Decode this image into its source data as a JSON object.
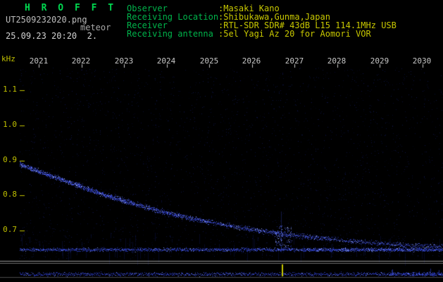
{
  "app": {
    "title": "H R O F F T",
    "filename": "UT2509232020.png",
    "mode_label": "meteor",
    "datetime": "25.09.23 20:20  2."
  },
  "header": {
    "observer_label": "Observer",
    "observer_value": ":Masaki Kano",
    "location_label": "Receiving Location",
    "location_value": ":Shibukawa,Gunma,Japan",
    "receiver_label": "Receiver",
    "receiver_value": ":RTL-SDR SDR# 43dB L15 114.1MHz USB",
    "antenna_label": "Receiving antenna",
    "antenna_value": ":5el Yagi Az 20 for Aomori VOR"
  },
  "chart_data": {
    "type": "heatmap",
    "subtype": "radio-meteor-spectrogram",
    "title": "",
    "xlabel": "",
    "ylabel": "kHz",
    "x_tick_labels": [
      "2021",
      "2022",
      "2023",
      "2024",
      "2025",
      "2026",
      "2027",
      "2028",
      "2029",
      "2030"
    ],
    "y_tick_labels": [
      "1.1",
      "1.0",
      "0.9",
      "0.8",
      "0.7"
    ],
    "x_minutes_range": [
      0.55,
      10.5
    ],
    "y_khz_range": [
      0.62,
      1.17
    ],
    "grid": false,
    "legend": "none",
    "drift_trace_points_min_khz": [
      [
        0.3,
        0.9
      ],
      [
        1.0,
        0.868
      ],
      [
        1.5,
        0.846
      ],
      [
        2.0,
        0.824
      ],
      [
        2.5,
        0.803
      ],
      [
        3.0,
        0.784
      ],
      [
        3.5,
        0.766
      ],
      [
        4.0,
        0.75
      ],
      [
        4.5,
        0.736
      ],
      [
        5.0,
        0.724
      ],
      [
        5.5,
        0.713
      ],
      [
        6.0,
        0.703
      ],
      [
        6.5,
        0.694
      ],
      [
        7.0,
        0.686
      ],
      [
        7.5,
        0.679
      ],
      [
        8.0,
        0.673
      ],
      [
        8.5,
        0.668
      ],
      [
        9.0,
        0.663
      ],
      [
        9.5,
        0.659
      ],
      [
        10.0,
        0.656
      ],
      [
        10.6,
        0.654
      ]
    ],
    "carrier_band_khz": 0.645,
    "echo_event": {
      "minute": 6.7,
      "khz_center": 0.685
    },
    "marker_minute": 6.7,
    "noise_seed": 20250923,
    "colors": {
      "background": "#000000",
      "title_green": "#00d850",
      "label_green": "#00b44b",
      "value_yellow": "#c8c800",
      "axis_yellow": "#c0c000",
      "time_white": "#c8c8c8",
      "noise_blue": "#2a3cc8",
      "bright_blue": "#96a6ff",
      "separator_gray": "#9a9a9a",
      "marker_yellow": "#c8c800"
    }
  }
}
